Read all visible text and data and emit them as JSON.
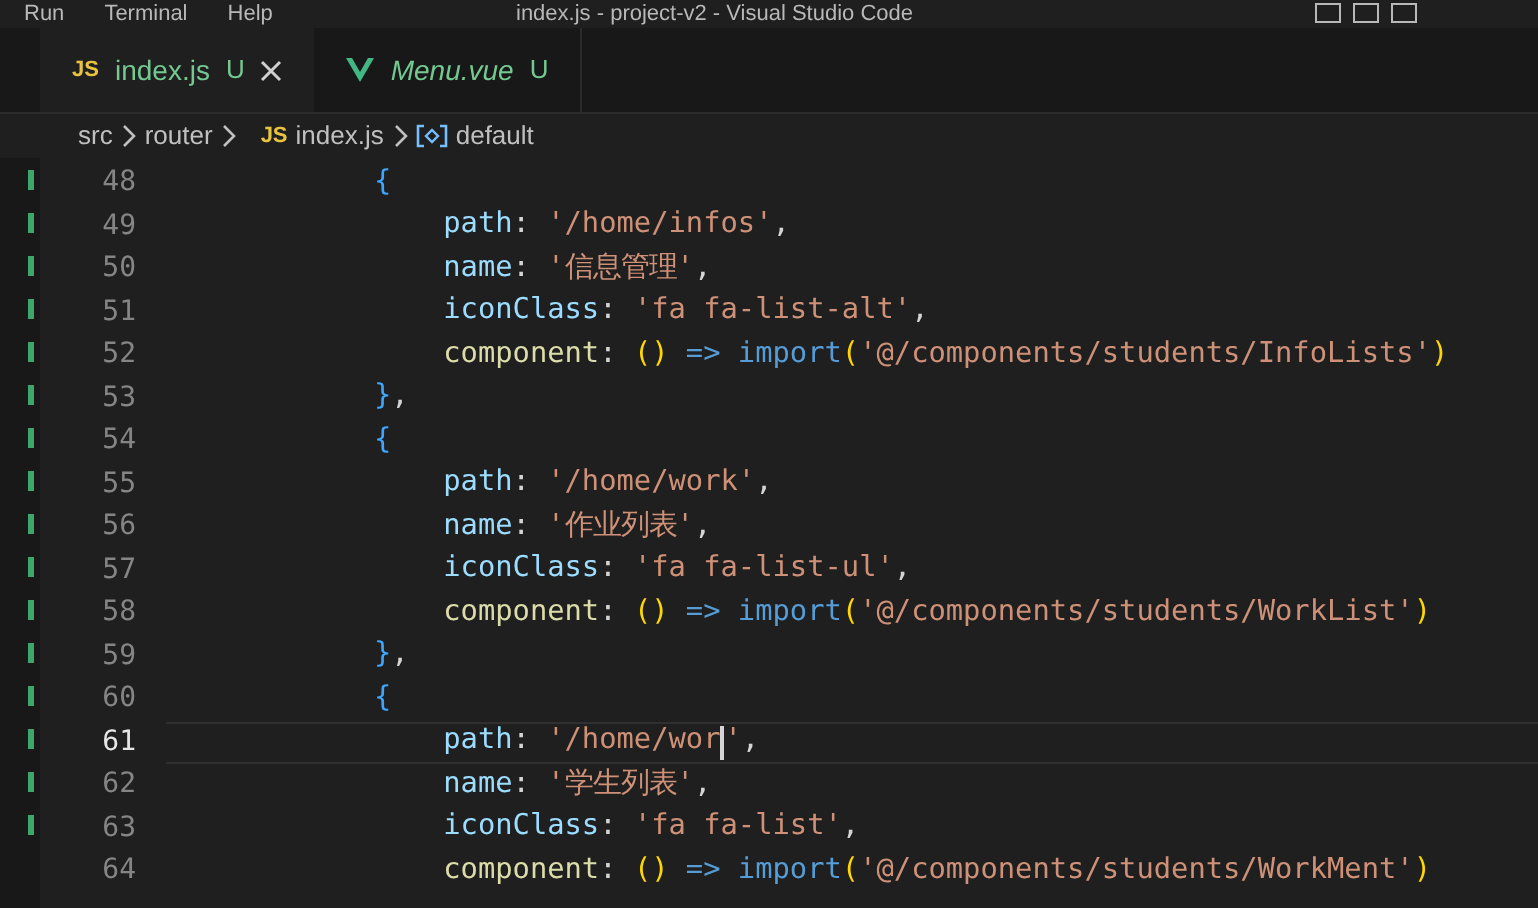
{
  "menu_bar": {
    "items": [
      "Run",
      "Terminal",
      "Help"
    ],
    "title": "index.js - project-v2 - Visual Studio Code"
  },
  "tabs": [
    {
      "file_badge": "JS",
      "kind": "js",
      "label": "index.js",
      "status": "U",
      "selected": true,
      "italic": false
    },
    {
      "kind": "vue",
      "label": "Menu.vue",
      "status": "U",
      "selected": false,
      "italic": true
    }
  ],
  "breadcrumb": {
    "items": [
      "src",
      "router"
    ],
    "file_badge": "JS",
    "file": "index.js",
    "symbol": "default"
  },
  "lines": [
    {
      "number": "48",
      "current": false,
      "tokens": [
        {
          "kind": "brace",
          "text": "            {"
        }
      ]
    },
    {
      "number": "49",
      "current": false,
      "tokens": [
        {
          "kind": "key",
          "text": "                path"
        },
        {
          "kind": "punct",
          "text": ": "
        },
        {
          "kind": "string",
          "text": "'/home/infos'"
        },
        {
          "kind": "punct",
          "text": ","
        }
      ]
    },
    {
      "number": "50",
      "current": false,
      "tokens": [
        {
          "kind": "key",
          "text": "                name"
        },
        {
          "kind": "punct",
          "text": ": "
        },
        {
          "kind": "string",
          "text": "'信息管理'"
        },
        {
          "kind": "punct",
          "text": ","
        }
      ]
    },
    {
      "number": "51",
      "current": false,
      "tokens": [
        {
          "kind": "key",
          "text": "                iconClass"
        },
        {
          "kind": "punct",
          "text": ": "
        },
        {
          "kind": "string",
          "text": "'fa fa-list-alt'"
        },
        {
          "kind": "punct",
          "text": ","
        }
      ]
    },
    {
      "number": "52",
      "current": false,
      "tokens": [
        {
          "kind": "func",
          "text": "                component"
        },
        {
          "kind": "punct",
          "text": ": "
        },
        {
          "kind": "paren",
          "text": "()"
        },
        {
          "kind": "keyword",
          "text": " => import"
        },
        {
          "kind": "paren",
          "text": "("
        },
        {
          "kind": "string",
          "text": "'@/components/students/InfoLists'"
        },
        {
          "kind": "paren",
          "text": ")"
        }
      ]
    },
    {
      "number": "53",
      "current": false,
      "tokens": [
        {
          "kind": "brace",
          "text": "            }"
        },
        {
          "kind": "punct",
          "text": ","
        }
      ]
    },
    {
      "number": "54",
      "current": false,
      "tokens": [
        {
          "kind": "brace",
          "text": "            {"
        }
      ]
    },
    {
      "number": "55",
      "current": false,
      "tokens": [
        {
          "kind": "key",
          "text": "                path"
        },
        {
          "kind": "punct",
          "text": ": "
        },
        {
          "kind": "string",
          "text": "'/home/work'"
        },
        {
          "kind": "punct",
          "text": ","
        }
      ]
    },
    {
      "number": "56",
      "current": false,
      "tokens": [
        {
          "kind": "key",
          "text": "                name"
        },
        {
          "kind": "punct",
          "text": ": "
        },
        {
          "kind": "string",
          "text": "'作业列表'"
        },
        {
          "kind": "punct",
          "text": ","
        }
      ]
    },
    {
      "number": "57",
      "current": false,
      "tokens": [
        {
          "kind": "key",
          "text": "                iconClass"
        },
        {
          "kind": "punct",
          "text": ": "
        },
        {
          "kind": "string",
          "text": "'fa fa-list-ul'"
        },
        {
          "kind": "punct",
          "text": ","
        }
      ]
    },
    {
      "number": "58",
      "current": false,
      "tokens": [
        {
          "kind": "func",
          "text": "                component"
        },
        {
          "kind": "punct",
          "text": ": "
        },
        {
          "kind": "paren",
          "text": "()"
        },
        {
          "kind": "keyword",
          "text": " => import"
        },
        {
          "kind": "paren",
          "text": "("
        },
        {
          "kind": "string",
          "text": "'@/components/students/WorkList'"
        },
        {
          "kind": "paren",
          "text": ")"
        }
      ]
    },
    {
      "number": "59",
      "current": false,
      "tokens": [
        {
          "kind": "brace",
          "text": "            }"
        },
        {
          "kind": "punct",
          "text": ","
        }
      ]
    },
    {
      "number": "60",
      "current": false,
      "tokens": [
        {
          "kind": "brace",
          "text": "            {"
        }
      ]
    },
    {
      "number": "61",
      "current": true,
      "tokens": [
        {
          "kind": "key",
          "text": "                path"
        },
        {
          "kind": "punct",
          "text": ": "
        },
        {
          "kind": "string",
          "text": "'/home/wor"
        },
        {
          "kind": "cursor"
        },
        {
          "kind": "string",
          "text": "'"
        },
        {
          "kind": "punct",
          "text": ","
        }
      ]
    },
    {
      "number": "62",
      "current": false,
      "tokens": [
        {
          "kind": "key",
          "text": "                name"
        },
        {
          "kind": "punct",
          "text": ": "
        },
        {
          "kind": "string",
          "text": "'学生列表'"
        },
        {
          "kind": "punct",
          "text": ","
        }
      ]
    },
    {
      "number": "63",
      "current": false,
      "tokens": [
        {
          "kind": "key",
          "text": "                iconClass"
        },
        {
          "kind": "punct",
          "text": ": "
        },
        {
          "kind": "string",
          "text": "'fa fa-list'"
        },
        {
          "kind": "punct",
          "text": ","
        }
      ]
    },
    {
      "number": "64",
      "current": false,
      "tokens": [
        {
          "kind": "func",
          "text": "                component"
        },
        {
          "kind": "punct",
          "text": ": "
        },
        {
          "kind": "paren",
          "text": "()"
        },
        {
          "kind": "keyword",
          "text": " => import"
        },
        {
          "kind": "paren",
          "text": "("
        },
        {
          "kind": "string",
          "text": "'@/components/students/WorkMent'"
        },
        {
          "kind": "paren",
          "text": ")"
        }
      ]
    }
  ]
}
